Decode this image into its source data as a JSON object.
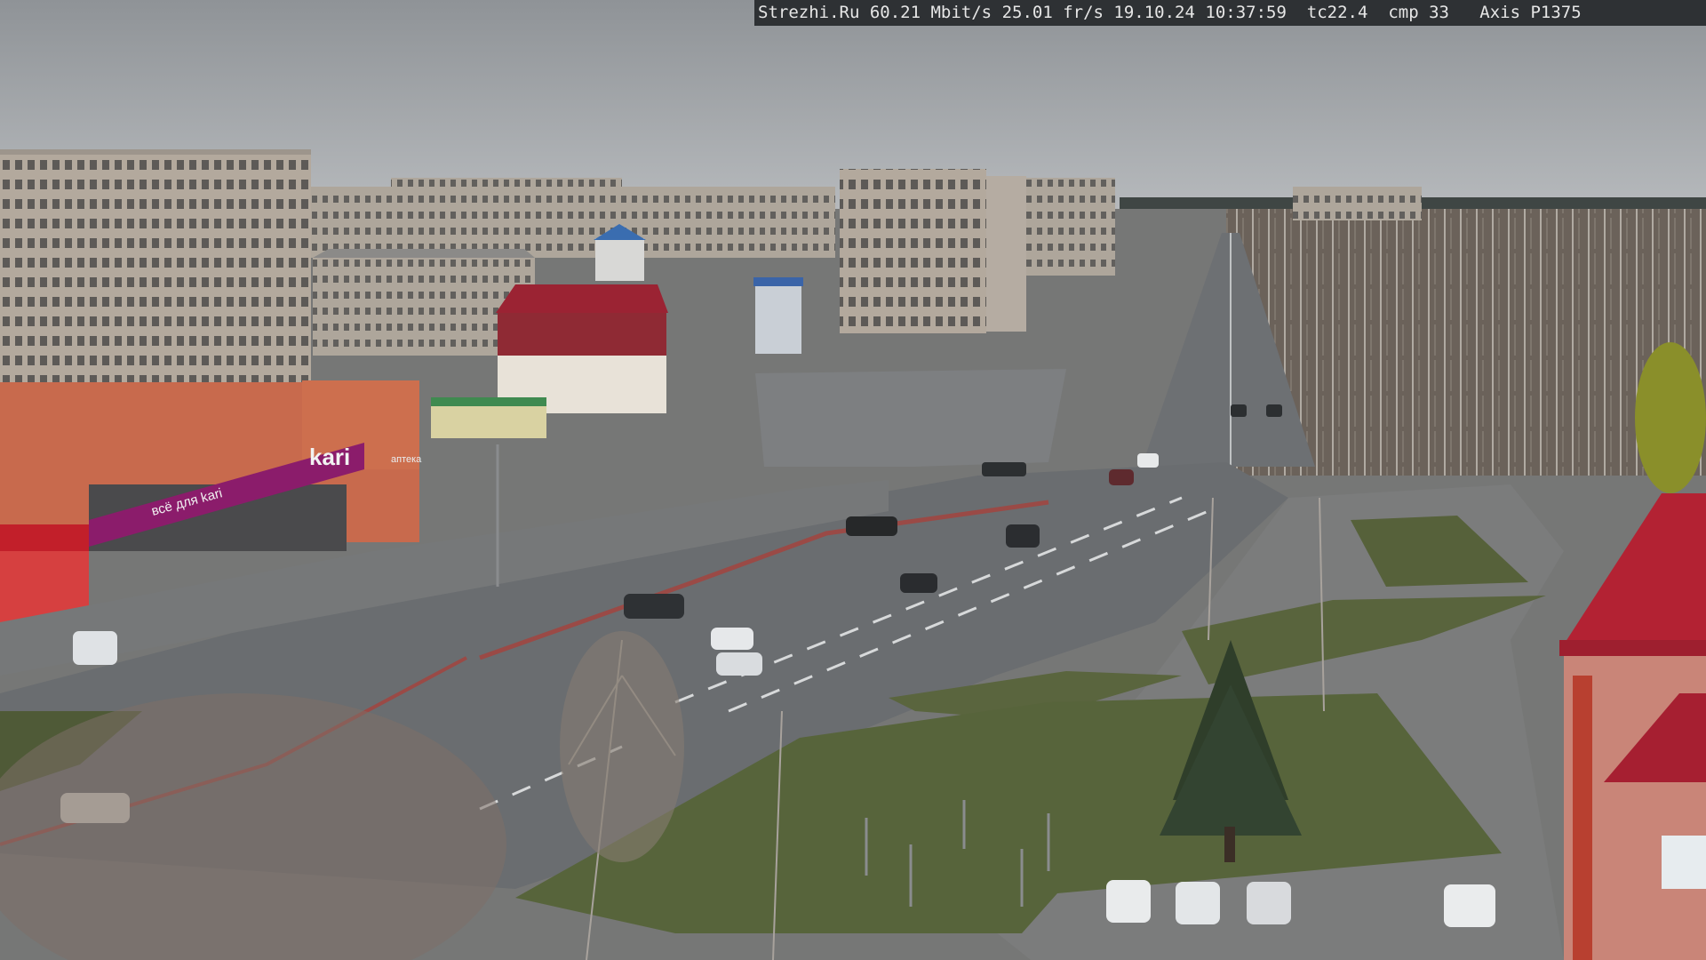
{
  "overlay": {
    "site": "Strezhi.Ru",
    "bitrate": "60.21 Mbit/s",
    "framerate": "25.01 fr/s",
    "date": "19.10.24",
    "time": "10:37:59",
    "tc": "tc22.4",
    "cmp": "cmp 33",
    "camera": "Axis P1375"
  },
  "signs": {
    "store_brand": "kari",
    "store_tagline": "всё для kari",
    "pharmacy": "аптека"
  },
  "colors": {
    "sky": "#a9acb0",
    "road": "#6e7174",
    "grass": "#55613a",
    "building_panel": "#b8aea3",
    "store_facade": "#c9694b",
    "kari_magenta": "#8b1c6b",
    "roof_red": "#9e1f2f",
    "overlay_bg": "#2e3134"
  }
}
